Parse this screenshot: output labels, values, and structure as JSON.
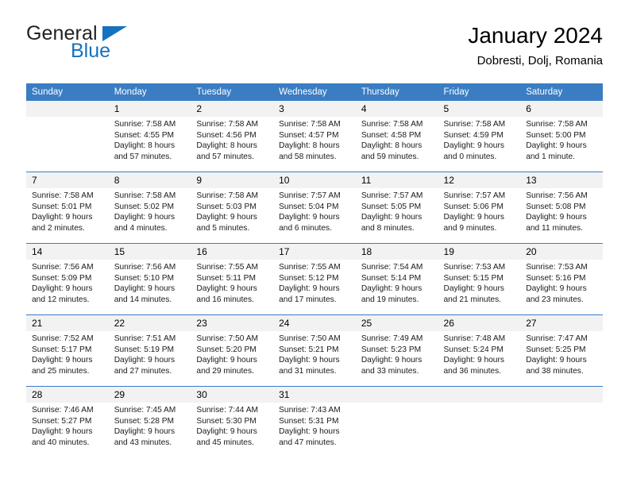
{
  "brand": {
    "name_top": "General",
    "name_bottom": "Blue",
    "accent_color": "#1572bf"
  },
  "header": {
    "title": "January 2024",
    "subtitle": "Dobresti, Dolj, Romania"
  },
  "theme": {
    "header_blue": "#3a7dc3",
    "daynum_bg": "#f2f2f2",
    "text": "#000000"
  },
  "weekday_headers": [
    "Sunday",
    "Monday",
    "Tuesday",
    "Wednesday",
    "Thursday",
    "Friday",
    "Saturday"
  ],
  "labels": {
    "sunrise_prefix": "Sunrise:",
    "sunset_prefix": "Sunset:",
    "daylight_prefix": "Daylight:"
  },
  "weeks": [
    [
      {
        "day": "",
        "sunrise": "",
        "sunset": "",
        "daylight_l1": "",
        "daylight_l2": ""
      },
      {
        "day": "1",
        "sunrise": "Sunrise: 7:58 AM",
        "sunset": "Sunset: 4:55 PM",
        "daylight_l1": "Daylight: 8 hours",
        "daylight_l2": "and 57 minutes."
      },
      {
        "day": "2",
        "sunrise": "Sunrise: 7:58 AM",
        "sunset": "Sunset: 4:56 PM",
        "daylight_l1": "Daylight: 8 hours",
        "daylight_l2": "and 57 minutes."
      },
      {
        "day": "3",
        "sunrise": "Sunrise: 7:58 AM",
        "sunset": "Sunset: 4:57 PM",
        "daylight_l1": "Daylight: 8 hours",
        "daylight_l2": "and 58 minutes."
      },
      {
        "day": "4",
        "sunrise": "Sunrise: 7:58 AM",
        "sunset": "Sunset: 4:58 PM",
        "daylight_l1": "Daylight: 8 hours",
        "daylight_l2": "and 59 minutes."
      },
      {
        "day": "5",
        "sunrise": "Sunrise: 7:58 AM",
        "sunset": "Sunset: 4:59 PM",
        "daylight_l1": "Daylight: 9 hours",
        "daylight_l2": "and 0 minutes."
      },
      {
        "day": "6",
        "sunrise": "Sunrise: 7:58 AM",
        "sunset": "Sunset: 5:00 PM",
        "daylight_l1": "Daylight: 9 hours",
        "daylight_l2": "and 1 minute."
      }
    ],
    [
      {
        "day": "7",
        "sunrise": "Sunrise: 7:58 AM",
        "sunset": "Sunset: 5:01 PM",
        "daylight_l1": "Daylight: 9 hours",
        "daylight_l2": "and 2 minutes."
      },
      {
        "day": "8",
        "sunrise": "Sunrise: 7:58 AM",
        "sunset": "Sunset: 5:02 PM",
        "daylight_l1": "Daylight: 9 hours",
        "daylight_l2": "and 4 minutes."
      },
      {
        "day": "9",
        "sunrise": "Sunrise: 7:58 AM",
        "sunset": "Sunset: 5:03 PM",
        "daylight_l1": "Daylight: 9 hours",
        "daylight_l2": "and 5 minutes."
      },
      {
        "day": "10",
        "sunrise": "Sunrise: 7:57 AM",
        "sunset": "Sunset: 5:04 PM",
        "daylight_l1": "Daylight: 9 hours",
        "daylight_l2": "and 6 minutes."
      },
      {
        "day": "11",
        "sunrise": "Sunrise: 7:57 AM",
        "sunset": "Sunset: 5:05 PM",
        "daylight_l1": "Daylight: 9 hours",
        "daylight_l2": "and 8 minutes."
      },
      {
        "day": "12",
        "sunrise": "Sunrise: 7:57 AM",
        "sunset": "Sunset: 5:06 PM",
        "daylight_l1": "Daylight: 9 hours",
        "daylight_l2": "and 9 minutes."
      },
      {
        "day": "13",
        "sunrise": "Sunrise: 7:56 AM",
        "sunset": "Sunset: 5:08 PM",
        "daylight_l1": "Daylight: 9 hours",
        "daylight_l2": "and 11 minutes."
      }
    ],
    [
      {
        "day": "14",
        "sunrise": "Sunrise: 7:56 AM",
        "sunset": "Sunset: 5:09 PM",
        "daylight_l1": "Daylight: 9 hours",
        "daylight_l2": "and 12 minutes."
      },
      {
        "day": "15",
        "sunrise": "Sunrise: 7:56 AM",
        "sunset": "Sunset: 5:10 PM",
        "daylight_l1": "Daylight: 9 hours",
        "daylight_l2": "and 14 minutes."
      },
      {
        "day": "16",
        "sunrise": "Sunrise: 7:55 AM",
        "sunset": "Sunset: 5:11 PM",
        "daylight_l1": "Daylight: 9 hours",
        "daylight_l2": "and 16 minutes."
      },
      {
        "day": "17",
        "sunrise": "Sunrise: 7:55 AM",
        "sunset": "Sunset: 5:12 PM",
        "daylight_l1": "Daylight: 9 hours",
        "daylight_l2": "and 17 minutes."
      },
      {
        "day": "18",
        "sunrise": "Sunrise: 7:54 AM",
        "sunset": "Sunset: 5:14 PM",
        "daylight_l1": "Daylight: 9 hours",
        "daylight_l2": "and 19 minutes."
      },
      {
        "day": "19",
        "sunrise": "Sunrise: 7:53 AM",
        "sunset": "Sunset: 5:15 PM",
        "daylight_l1": "Daylight: 9 hours",
        "daylight_l2": "and 21 minutes."
      },
      {
        "day": "20",
        "sunrise": "Sunrise: 7:53 AM",
        "sunset": "Sunset: 5:16 PM",
        "daylight_l1": "Daylight: 9 hours",
        "daylight_l2": "and 23 minutes."
      }
    ],
    [
      {
        "day": "21",
        "sunrise": "Sunrise: 7:52 AM",
        "sunset": "Sunset: 5:17 PM",
        "daylight_l1": "Daylight: 9 hours",
        "daylight_l2": "and 25 minutes."
      },
      {
        "day": "22",
        "sunrise": "Sunrise: 7:51 AM",
        "sunset": "Sunset: 5:19 PM",
        "daylight_l1": "Daylight: 9 hours",
        "daylight_l2": "and 27 minutes."
      },
      {
        "day": "23",
        "sunrise": "Sunrise: 7:50 AM",
        "sunset": "Sunset: 5:20 PM",
        "daylight_l1": "Daylight: 9 hours",
        "daylight_l2": "and 29 minutes."
      },
      {
        "day": "24",
        "sunrise": "Sunrise: 7:50 AM",
        "sunset": "Sunset: 5:21 PM",
        "daylight_l1": "Daylight: 9 hours",
        "daylight_l2": "and 31 minutes."
      },
      {
        "day": "25",
        "sunrise": "Sunrise: 7:49 AM",
        "sunset": "Sunset: 5:23 PM",
        "daylight_l1": "Daylight: 9 hours",
        "daylight_l2": "and 33 minutes."
      },
      {
        "day": "26",
        "sunrise": "Sunrise: 7:48 AM",
        "sunset": "Sunset: 5:24 PM",
        "daylight_l1": "Daylight: 9 hours",
        "daylight_l2": "and 36 minutes."
      },
      {
        "day": "27",
        "sunrise": "Sunrise: 7:47 AM",
        "sunset": "Sunset: 5:25 PM",
        "daylight_l1": "Daylight: 9 hours",
        "daylight_l2": "and 38 minutes."
      }
    ],
    [
      {
        "day": "28",
        "sunrise": "Sunrise: 7:46 AM",
        "sunset": "Sunset: 5:27 PM",
        "daylight_l1": "Daylight: 9 hours",
        "daylight_l2": "and 40 minutes."
      },
      {
        "day": "29",
        "sunrise": "Sunrise: 7:45 AM",
        "sunset": "Sunset: 5:28 PM",
        "daylight_l1": "Daylight: 9 hours",
        "daylight_l2": "and 43 minutes."
      },
      {
        "day": "30",
        "sunrise": "Sunrise: 7:44 AM",
        "sunset": "Sunset: 5:30 PM",
        "daylight_l1": "Daylight: 9 hours",
        "daylight_l2": "and 45 minutes."
      },
      {
        "day": "31",
        "sunrise": "Sunrise: 7:43 AM",
        "sunset": "Sunset: 5:31 PM",
        "daylight_l1": "Daylight: 9 hours",
        "daylight_l2": "and 47 minutes."
      },
      {
        "day": "",
        "sunrise": "",
        "sunset": "",
        "daylight_l1": "",
        "daylight_l2": ""
      },
      {
        "day": "",
        "sunrise": "",
        "sunset": "",
        "daylight_l1": "",
        "daylight_l2": ""
      },
      {
        "day": "",
        "sunrise": "",
        "sunset": "",
        "daylight_l1": "",
        "daylight_l2": ""
      }
    ]
  ]
}
